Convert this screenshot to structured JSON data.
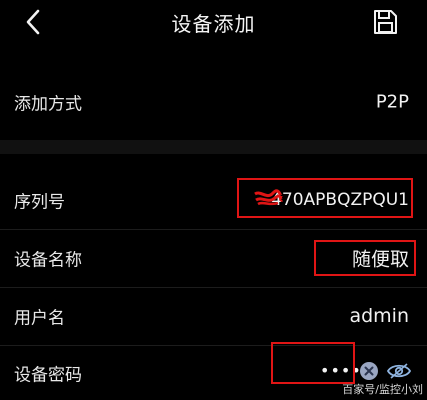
{
  "header": {
    "title": "设备添加",
    "back_icon": "chevron-left-icon",
    "save_icon": "floppy-disk-icon"
  },
  "rows": {
    "add_method": {
      "label": "添加方式",
      "value": "P2P"
    },
    "serial": {
      "label": "序列号",
      "value": "470APBQZPQU1"
    },
    "device_name": {
      "label": "设备名称",
      "value": "随便取"
    },
    "username": {
      "label": "用户名",
      "value": "admin"
    },
    "password": {
      "label": "设备密码",
      "value": "•••••"
    }
  },
  "watermark": "百家号/监控小刘",
  "colors": {
    "background": "#000000",
    "text": "#f2f2f2",
    "annotation": "#e01515",
    "clear_button": "#9aa6c2",
    "eye_icon": "#8fb4e0"
  }
}
